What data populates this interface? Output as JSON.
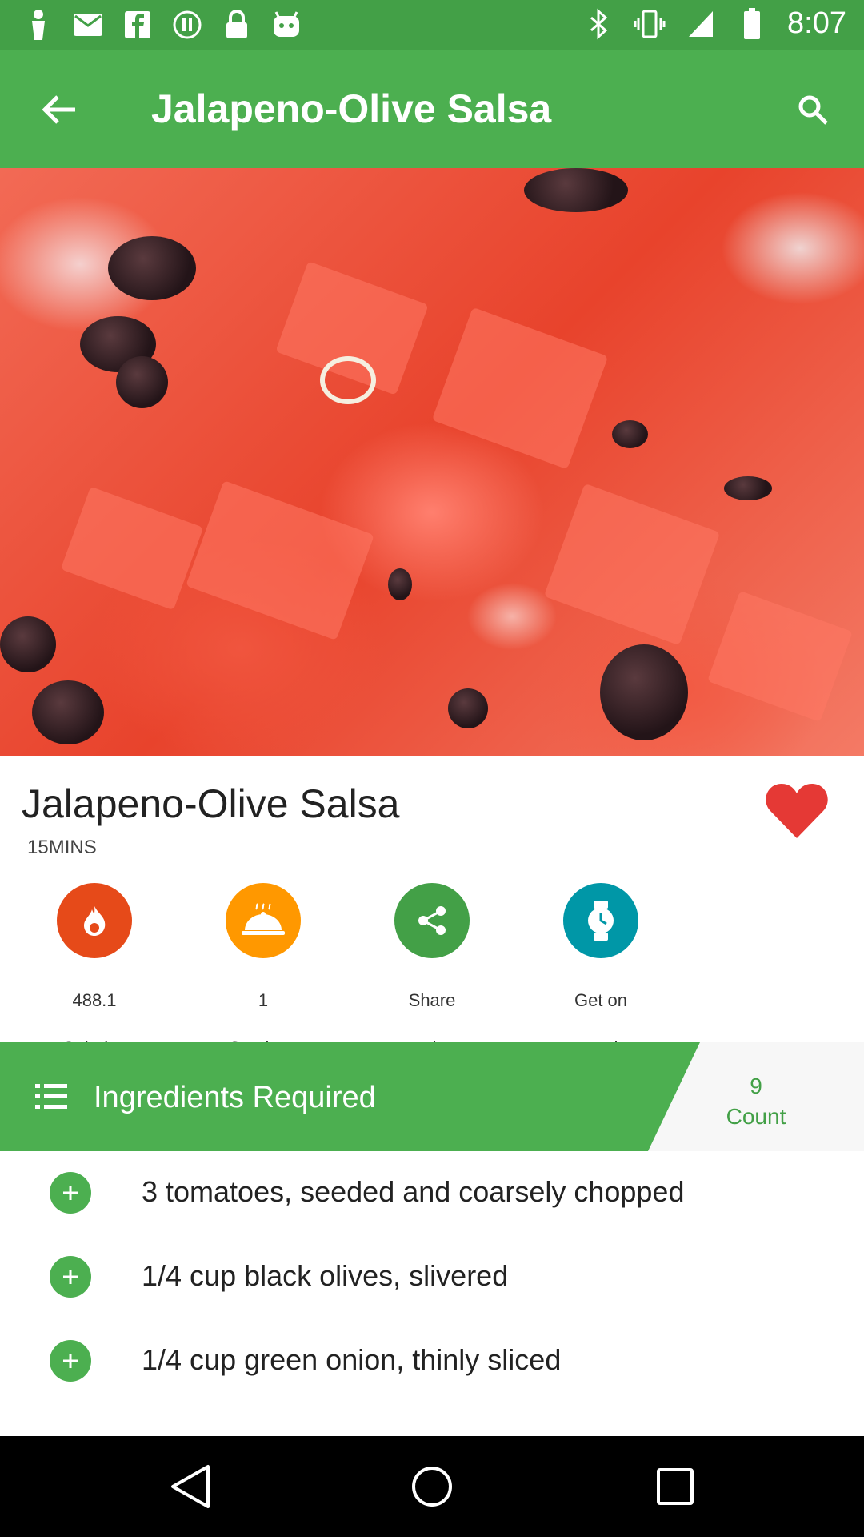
{
  "status_bar": {
    "time": "8:07",
    "left_icons": [
      "notification-icon",
      "mail-icon",
      "facebook-icon",
      "pause-icon",
      "lock-icon",
      "android-icon"
    ],
    "right_icons": [
      "bluetooth-icon",
      "vibrate-icon",
      "signal-icon",
      "battery-icon"
    ]
  },
  "app_bar": {
    "title": "Jalapeno-Olive Salsa"
  },
  "recipe": {
    "title": "Jalapeno-Olive Salsa",
    "time": "15MINS",
    "favorited": true
  },
  "stats": [
    {
      "value": "488.1",
      "label": "Calories",
      "color": "#e64a19"
    },
    {
      "value": "1",
      "label": "Servings",
      "color": "#ff9800"
    },
    {
      "value": "Share",
      "label": "recipe",
      "color": "#43a047"
    },
    {
      "value": "Get on",
      "label": "watch",
      "color": "#0097a7"
    }
  ],
  "ingredients_header": {
    "title": "Ingredients Required",
    "count_value": "9",
    "count_label": "Count"
  },
  "ingredients": [
    {
      "text": "3 tomatoes, seeded and coarsely chopped"
    },
    {
      "text": "1/4 cup black olives, slivered"
    },
    {
      "text": "1/4 cup green onion, thinly sliced"
    }
  ],
  "colors": {
    "primary": "#4caf50",
    "primary_dark": "#43a047",
    "heart": "#e53935"
  }
}
